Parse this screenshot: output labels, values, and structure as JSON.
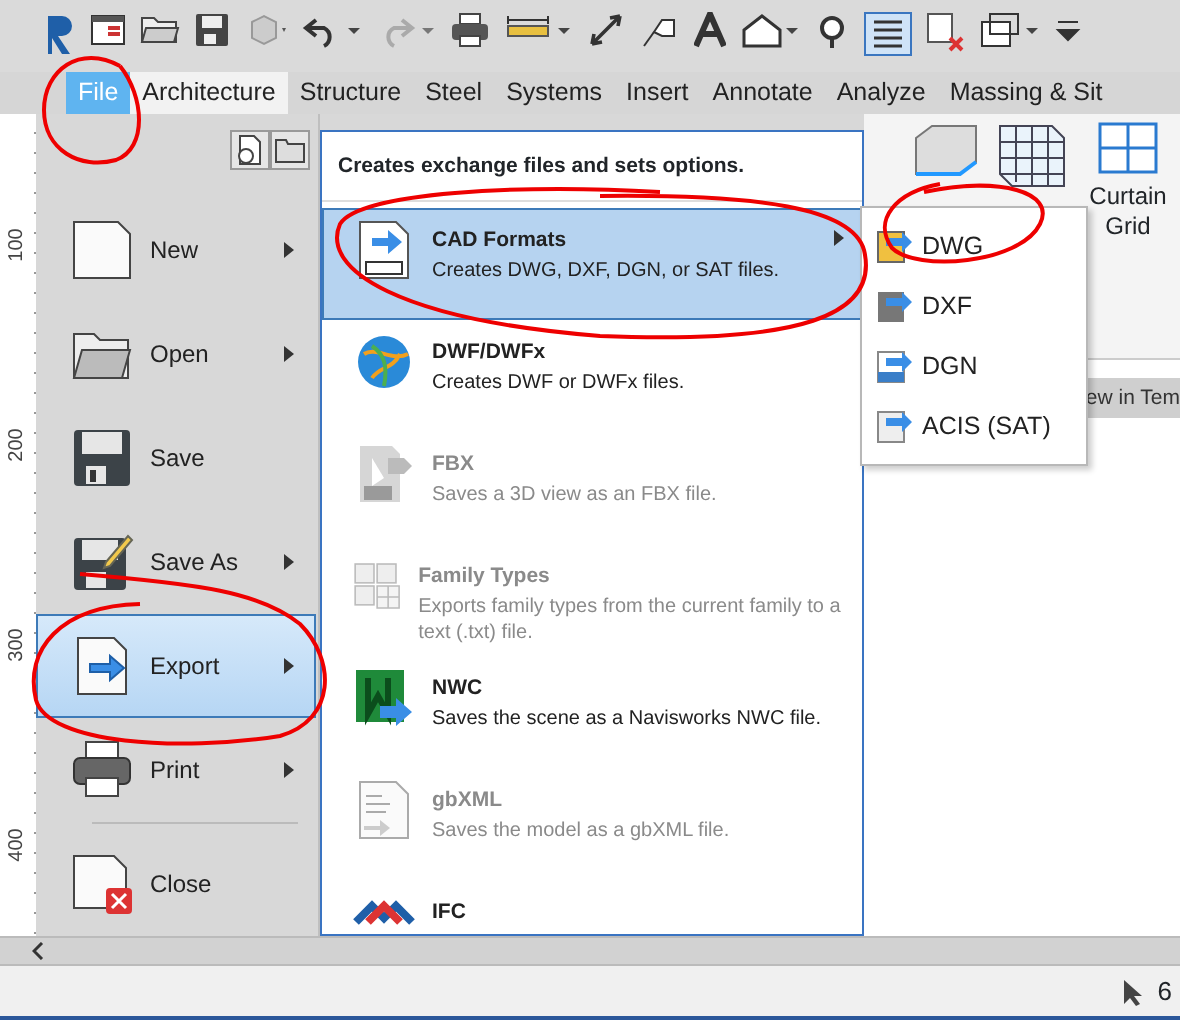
{
  "ribbon_tabs": [
    {
      "label": "File",
      "selected": true
    },
    {
      "label": "Architecture",
      "selected": false
    },
    {
      "label": "Structure",
      "selected": false
    },
    {
      "label": "Steel",
      "selected": false
    },
    {
      "label": "Systems",
      "selected": false
    },
    {
      "label": "Insert",
      "selected": false
    },
    {
      "label": "Annotate",
      "selected": false
    },
    {
      "label": "Analyze",
      "selected": false
    },
    {
      "label": "Massing & Sit",
      "selected": false
    }
  ],
  "ribbon_panel": {
    "button_label": "Curtain Grid"
  },
  "view_strip": {
    "text": "ew in Tem"
  },
  "ruler": {
    "labels": [
      "100",
      "200",
      "300",
      "400"
    ]
  },
  "file_menu": {
    "left_items": [
      {
        "label": "New",
        "has_submenu": true,
        "selected": false
      },
      {
        "label": "Open",
        "has_submenu": true,
        "selected": false
      },
      {
        "label": "Save",
        "has_submenu": false,
        "selected": false
      },
      {
        "label": "Save As",
        "has_submenu": true,
        "selected": false
      },
      {
        "label": "Export",
        "has_submenu": true,
        "selected": true
      },
      {
        "label": "Print",
        "has_submenu": true,
        "selected": false
      },
      {
        "label": "Close",
        "has_submenu": false,
        "selected": false
      }
    ],
    "header": "Creates exchange files and sets options.",
    "right_items": [
      {
        "title": "CAD Formats",
        "description": "Creates DWG, DXF, DGN, or SAT files.",
        "selected": true,
        "disabled": false,
        "has_submenu": true
      },
      {
        "title": "DWF/DWFx",
        "description": "Creates DWF or DWFx files.",
        "selected": false,
        "disabled": false,
        "has_submenu": false
      },
      {
        "title": "FBX",
        "description": "Saves a 3D view as an FBX file.",
        "selected": false,
        "disabled": true,
        "has_submenu": false
      },
      {
        "title": "Family Types",
        "description": "Exports family types from the current family to a text (.txt) file.",
        "selected": false,
        "disabled": true,
        "has_submenu": false
      },
      {
        "title": "NWC",
        "description": "Saves the scene as a Navisworks NWC file.",
        "selected": false,
        "disabled": false,
        "has_submenu": false
      },
      {
        "title": "gbXML",
        "description": "Saves the model as a gbXML file.",
        "selected": false,
        "disabled": true,
        "has_submenu": false
      },
      {
        "title": "IFC",
        "selected": false,
        "disabled": false,
        "has_submenu": false
      }
    ],
    "submenu": [
      {
        "label": "DWG"
      },
      {
        "label": "DXF"
      },
      {
        "label": "DGN"
      },
      {
        "label": "ACIS (SAT)"
      }
    ]
  },
  "status_bar": {
    "text": "6"
  }
}
